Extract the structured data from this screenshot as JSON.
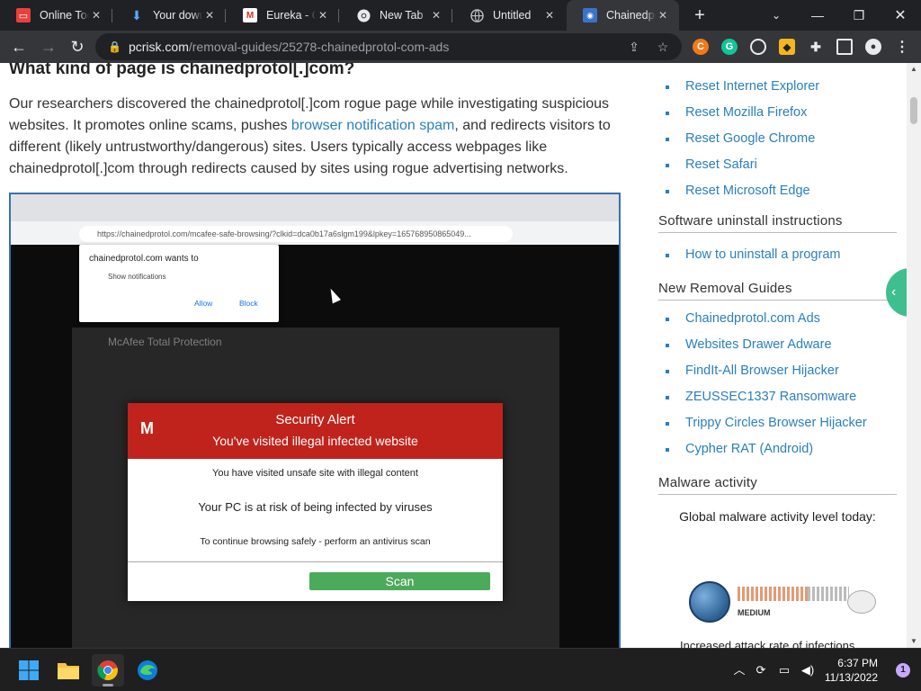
{
  "colors": {
    "link": "#2a7fbc",
    "chrome_frame": "#202124",
    "chrome_toolbar": "#35363a",
    "alert_red": "#c0231c",
    "scan_green": "#4caa5b",
    "screenshot_border": "#3a70b0"
  },
  "browser": {
    "tabs": [
      {
        "title": "Online Tool",
        "icon": "google-slides-icon"
      },
      {
        "title": "Your downl",
        "icon": "download-icon"
      },
      {
        "title": "Eureka - Ch",
        "icon": "gmail-icon"
      },
      {
        "title": "New Tab",
        "icon": "chrome-icon"
      },
      {
        "title": "Untitled",
        "icon": "globe-icon"
      },
      {
        "title": "Chainedpro",
        "icon": "pcrisk-icon",
        "active": true
      }
    ],
    "address": {
      "host": "pcrisk.com",
      "path": "/removal-guides/25278-chainedprotol-com-ads"
    }
  },
  "article": {
    "heading": "What kind of page is chainedprotol[.]com?",
    "para_part1": "Our researchers discovered the chainedprotol[.]com rogue page while investigating suspicious websites. It promotes online scams, pushes ",
    "para_link": "browser notification spam",
    "para_part2": ", and redirects visitors to different (likely untrustworthy/dangerous) sites. Users typically access webpages like chainedprotol[.]com through redirects caused by sites using rogue advertising networks."
  },
  "screenshot": {
    "url": "https://chainedprotol.com/mcafee-safe-browsing/?clkid=dca0b17a6slgm199&lpkey=165768950865049...",
    "notification": {
      "origin": "chainedprotol.com wants to",
      "request": "Show notifications",
      "allow": "Allow",
      "block": "Block"
    },
    "mcafee_window_title": "McAfee Total Protection",
    "alert": {
      "title": "Security Alert",
      "subtitle": "You've visited illegal infected website",
      "line1": "You have visited unsafe site with illegal content",
      "line2": "Your PC is at risk of being infected by viruses",
      "line3": "To continue browsing safely - perform an antivirus scan",
      "scan_button": "Scan"
    }
  },
  "sidebar": {
    "reset_links": [
      "Reset Internet Explorer",
      "Reset Mozilla Firefox",
      "Reset Google Chrome",
      "Reset Safari",
      "Reset Microsoft Edge"
    ],
    "uninstall_heading": "Software uninstall instructions",
    "uninstall_links": [
      "How to uninstall a program"
    ],
    "new_guides_heading": "New Removal Guides",
    "new_guides": [
      "Chainedprotol.com Ads",
      "Websites Drawer Adware",
      "FindIt-All Browser Hijacker",
      "ZEUSSEC1337 Ransomware",
      "Trippy Circles Browser Hijacker",
      "Cypher RAT (Android)"
    ],
    "malware_heading": "Malware activity",
    "malware_label": "Global malware activity level today:",
    "malware_level": "MEDIUM",
    "footer_partial": "Increased attack rate of infections"
  },
  "taskbar": {
    "apps": [
      "start-icon",
      "file-explorer-icon",
      "chrome-icon",
      "edge-icon"
    ],
    "time": "6:37 PM",
    "date": "11/13/2022",
    "notifications": "1"
  }
}
